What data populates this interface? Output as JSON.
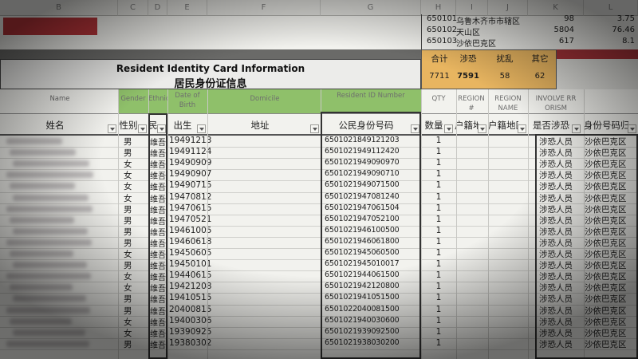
{
  "columns": [
    "B",
    "C",
    "D",
    "E",
    "F",
    "G",
    "H",
    "I",
    "J",
    "K",
    "L"
  ],
  "top_table": {
    "rows": [
      {
        "code": "650101",
        "name": "乌鲁木齐市市辖区",
        "n1": "98",
        "n2": "3.75"
      },
      {
        "code": "650102",
        "name": "天山区",
        "n1": "5804",
        "n2": "76.46"
      },
      {
        "code": "650103",
        "name": "沙依巴克区",
        "n1": "617",
        "n2": "8.1"
      }
    ]
  },
  "title": {
    "en": "Resident Identity Card Information",
    "cn": "居民身份证信息"
  },
  "summary": {
    "labels": [
      "合计",
      "涉恐",
      "扰乱",
      "其它"
    ],
    "values": [
      "7711",
      "7591",
      "58",
      "62"
    ]
  },
  "headers": {
    "name": {
      "en": "Name",
      "cn": "姓名"
    },
    "gender": {
      "en": "Gender",
      "cn": "性别"
    },
    "ethnic": {
      "en": "Ethnicit",
      "cn": "民族"
    },
    "dob": {
      "en": "Date of Birth",
      "cn": "出生"
    },
    "domicile": {
      "en": "Domicile",
      "cn": "地址"
    },
    "id": {
      "en": "Resident ID Number",
      "cn": "公民身份号码"
    },
    "qty": {
      "en": "QTY",
      "cn": "数量"
    },
    "region_no": {
      "en": "REGION #",
      "cn": "户籍地区号"
    },
    "region_name": {
      "en": "REGION NAME",
      "cn": "户籍地区号名称"
    },
    "involved": {
      "en": "INVOLVE RR ORISM",
      "cn": "是否涉恐"
    },
    "id_region": {
      "en": "",
      "cn": "身份号码归属地"
    }
  },
  "rows": [
    {
      "gender": "男",
      "ethnic": "维吾",
      "dob": "19491213",
      "id": "6501021849121203",
      "qty": "1",
      "involved": "涉恐人员",
      "region": "沙依巴克区"
    },
    {
      "gender": "男",
      "ethnic": "维吾",
      "dob": "19491124",
      "id": "6501021949112420",
      "qty": "1",
      "involved": "涉恐人员",
      "region": "沙依巴克区"
    },
    {
      "gender": "女",
      "ethnic": "维吾",
      "dob": "19490909",
      "id": "6501021949090970",
      "qty": "1",
      "involved": "涉恐人员",
      "region": "沙依巴克区"
    },
    {
      "gender": "女",
      "ethnic": "维吾",
      "dob": "19490907",
      "id": "6501021949090710",
      "qty": "1",
      "involved": "涉恐人员",
      "region": "沙依巴克区"
    },
    {
      "gender": "女",
      "ethnic": "维吾",
      "dob": "19490715",
      "id": "6501021949071500",
      "qty": "1",
      "involved": "涉恐人员",
      "region": "沙依巴克区"
    },
    {
      "gender": "女",
      "ethnic": "维吾",
      "dob": "19470812",
      "id": "6501021947081240",
      "qty": "1",
      "involved": "涉恐人员",
      "region": "沙依巴克区"
    },
    {
      "gender": "男",
      "ethnic": "维吾",
      "dob": "19470615",
      "id": "6501021947061504",
      "qty": "1",
      "involved": "涉恐人员",
      "region": "沙依巴克区"
    },
    {
      "gender": "男",
      "ethnic": "维吾",
      "dob": "19470521",
      "id": "6501021947052100",
      "qty": "1",
      "involved": "涉恐人员",
      "region": "沙依巴克区"
    },
    {
      "gender": "男",
      "ethnic": "维吾",
      "dob": "19461005",
      "id": "6501021946100500",
      "qty": "1",
      "involved": "涉恐人员",
      "region": "沙依巴克区"
    },
    {
      "gender": "男",
      "ethnic": "维吾",
      "dob": "19460618",
      "id": "6501021946061800",
      "qty": "1",
      "involved": "涉恐人员",
      "region": "沙依巴克区"
    },
    {
      "gender": "女",
      "ethnic": "维吾",
      "dob": "19450605",
      "id": "6501021945060500",
      "qty": "1",
      "involved": "涉恐人员",
      "region": "沙依巴克区"
    },
    {
      "gender": "男",
      "ethnic": "维吾",
      "dob": "19450101",
      "id": "6501021945010017",
      "qty": "1",
      "involved": "涉恐人员",
      "region": "沙依巴克区"
    },
    {
      "gender": "女",
      "ethnic": "维吾",
      "dob": "19440615",
      "id": "6501021944061500",
      "qty": "1",
      "involved": "涉恐人员",
      "region": "沙依巴克区"
    },
    {
      "gender": "女",
      "ethnic": "维吾",
      "dob": "19421208",
      "id": "6501021942120800",
      "qty": "1",
      "involved": "涉恐人员",
      "region": "沙依巴克区"
    },
    {
      "gender": "男",
      "ethnic": "维吾",
      "dob": "19410515",
      "id": "6501021941051500",
      "qty": "1",
      "involved": "涉恐人员",
      "region": "沙依巴克区"
    },
    {
      "gender": "男",
      "ethnic": "维吾",
      "dob": "20400815",
      "id": "6501022040081500",
      "qty": "1",
      "involved": "涉恐人员",
      "region": "沙依巴克区"
    },
    {
      "gender": "女",
      "ethnic": "维吾",
      "dob": "19400306",
      "id": "6501021940030600",
      "qty": "1",
      "involved": "涉恐人员",
      "region": "沙依巴克区"
    },
    {
      "gender": "女",
      "ethnic": "维吾",
      "dob": "19390925",
      "id": "6501021939092500",
      "qty": "1",
      "involved": "涉恐人员",
      "region": "沙依巴克区"
    },
    {
      "gender": "男",
      "ethnic": "维吾",
      "dob": "19380302",
      "id": "6501021938030200",
      "qty": "1",
      "involved": "涉恐人员",
      "region": "沙依巴克区"
    }
  ],
  "colors": {
    "green_header": "#8fc06a",
    "orange_summary": "#e8b560",
    "redacted_red": "#b8353a",
    "dark_band": "#5c5c5c"
  }
}
